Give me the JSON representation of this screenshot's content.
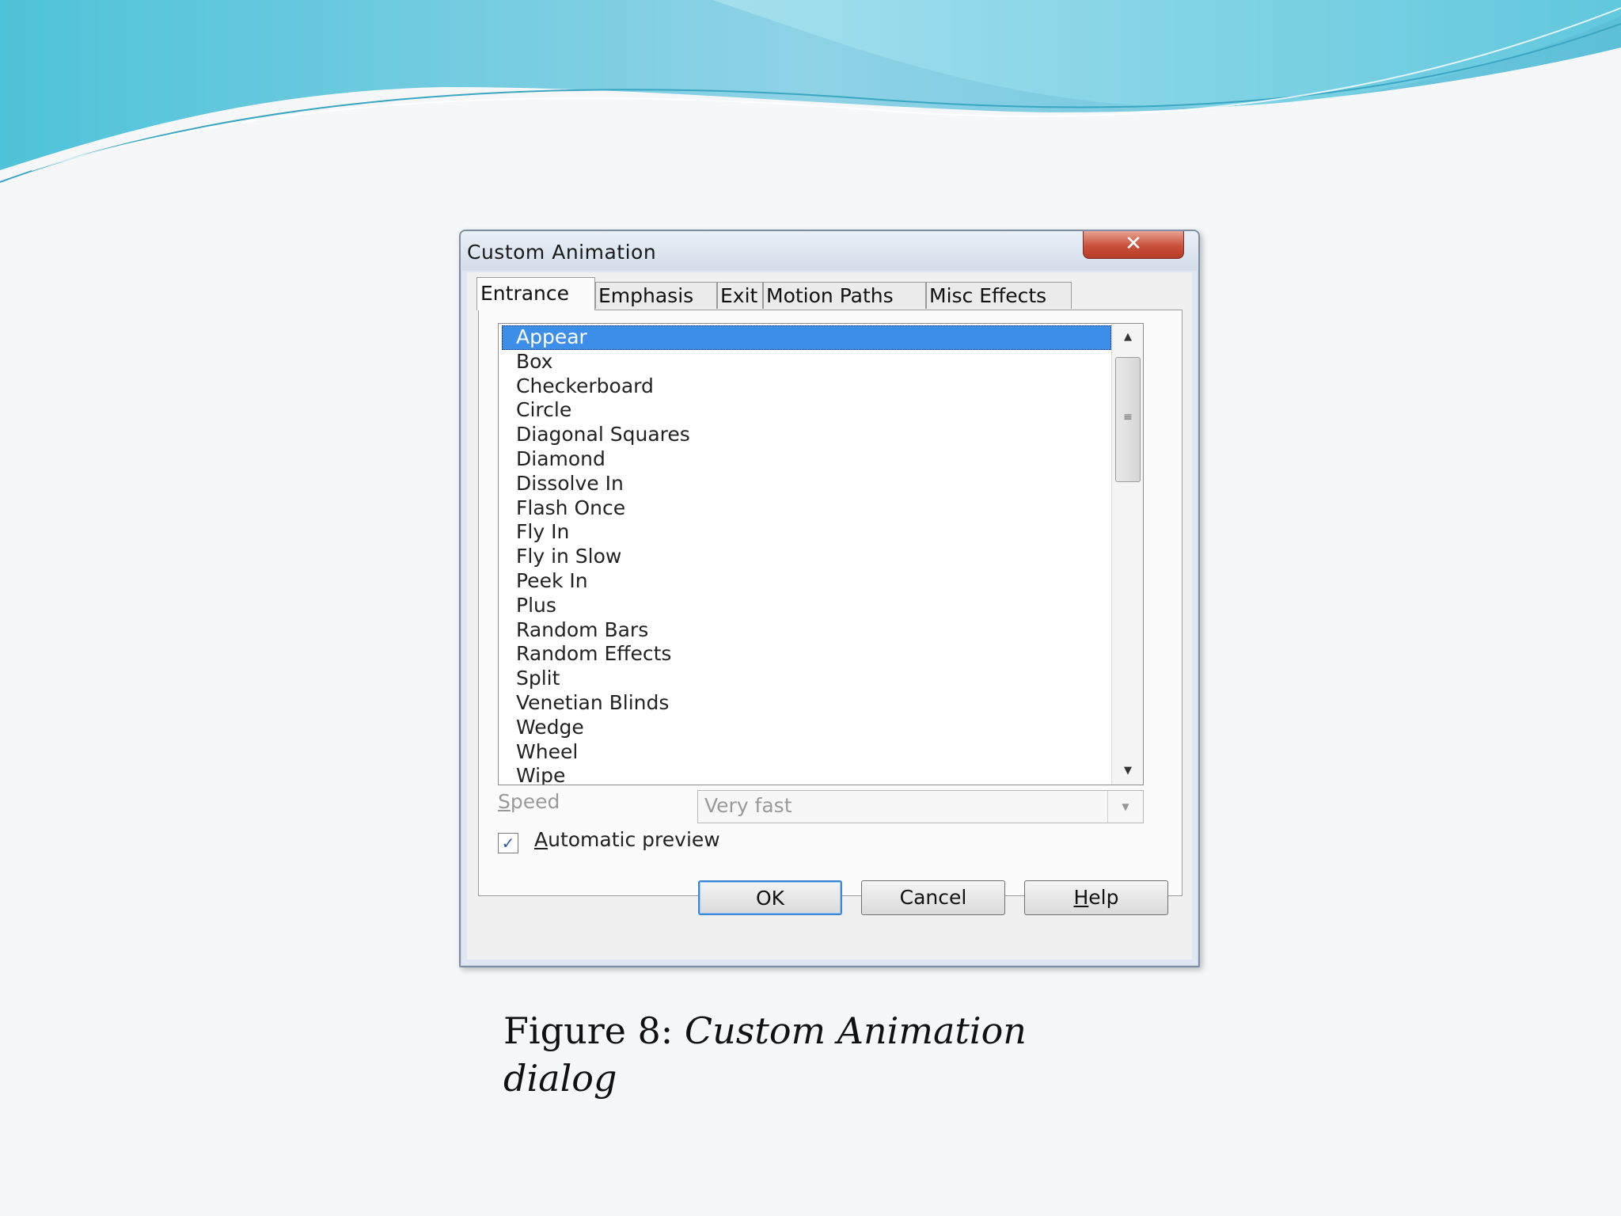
{
  "dialog": {
    "title": "Custom Animation",
    "close_icon": "close-icon",
    "tabs": [
      {
        "label": "Entrance",
        "active": true
      },
      {
        "label": "Emphasis",
        "active": false
      },
      {
        "label": "Exit",
        "active": false
      },
      {
        "label": "Motion Paths",
        "active": false
      },
      {
        "label": "Misc Effects",
        "active": false
      }
    ],
    "effects": [
      "Appear",
      "Box",
      "Checkerboard",
      "Circle",
      "Diagonal Squares",
      "Diamond",
      "Dissolve In",
      "Flash Once",
      "Fly In",
      "Fly in Slow",
      "Peek In",
      "Plus",
      "Random Bars",
      "Random Effects",
      "Split",
      "Venetian Blinds",
      "Wedge",
      "Wheel",
      "Wipe"
    ],
    "selected_effect": "Appear",
    "speed": {
      "label_first": "S",
      "label_rest": "peed",
      "value": "Very fast",
      "disabled": true
    },
    "automatic_preview": {
      "label_first": "A",
      "label_rest": "utomatic preview",
      "checked": true
    },
    "buttons": {
      "ok": "OK",
      "cancel": "Cancel",
      "help_first": "H",
      "help_rest": "elp"
    }
  },
  "caption": {
    "prefix": "Figure 8: ",
    "italic": "Custom Animation dialog"
  },
  "colors": {
    "selection": "#3d8ee8",
    "close_button": "#c9503a",
    "banner_teal": "#4fc3d9"
  }
}
